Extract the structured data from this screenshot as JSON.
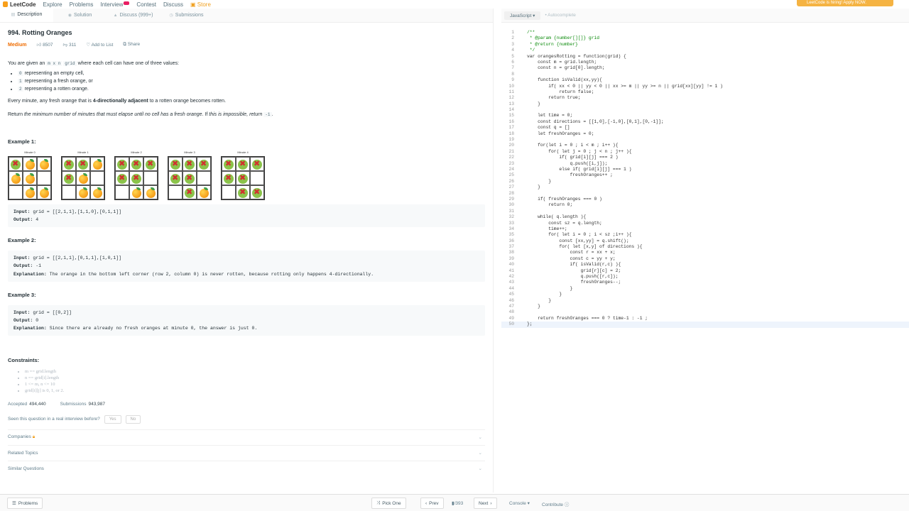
{
  "topnav": {
    "logo": "LeetCode",
    "items": [
      "Explore",
      "Problems",
      "Interview",
      "Contest",
      "Discuss",
      "Store"
    ],
    "banner": "LeetCode is hiring! Apply NOW."
  },
  "tabs": [
    "Description",
    "Solution",
    "Discuss (999+)",
    "Submissions"
  ],
  "problem": {
    "title": "994. Rotting Oranges",
    "difficulty": "Medium",
    "likes": "8507",
    "dislikes": "311",
    "add_to_list": "Add to List",
    "share": "Share",
    "intro_pre": "You are given an",
    "intro_code": "m x n",
    "intro_code2": "grid",
    "intro_post": "where each cell can have one of three values:",
    "values": [
      {
        "code": "0",
        "text": "representing an empty cell,"
      },
      {
        "code": "1",
        "text": "representing a fresh orange, or"
      },
      {
        "code": "2",
        "text": "representing a rotten orange."
      }
    ],
    "para2_pre": "Every minute, any fresh orange that is",
    "para2_bold": "4-directionally adjacent",
    "para2_post": "to a rotten orange becomes rotten.",
    "para3_pre": "Return",
    "para3_italic": "the minimum number of minutes that must elapse until no cell has a fresh orange",
    "para3_mid": ". If",
    "para3_italic2": "this is impossible, return",
    "para3_code": "-1",
    "para3_end": "."
  },
  "examples": [
    {
      "heading": "Example 1:",
      "input": "grid = [[2,1,1],[1,1,0],[0,1,1]]",
      "output": "4",
      "explanation": ""
    },
    {
      "heading": "Example 2:",
      "input": "grid = [[2,1,1],[0,1,1],[1,0,1]]",
      "output": "-1",
      "explanation": "The orange in the bottom left corner (row 2, column 0) is never rotten, because rotting only happens 4-directionally."
    },
    {
      "heading": "Example 3:",
      "input": "grid = [[0,2]]",
      "output": "0",
      "explanation": "Since there are already no fresh oranges at minute 0, the answer is just 0."
    }
  ],
  "labels": {
    "input": "Input:",
    "output": "Output:",
    "explanation": "Explanation:"
  },
  "minutes": [
    {
      "caption": "Minute 0",
      "cells": [
        2,
        1,
        1,
        1,
        1,
        0,
        0,
        1,
        1
      ]
    },
    {
      "caption": "Minute 1",
      "cells": [
        2,
        2,
        1,
        2,
        1,
        0,
        0,
        1,
        1
      ]
    },
    {
      "caption": "Minute 2",
      "cells": [
        2,
        2,
        2,
        2,
        2,
        0,
        0,
        1,
        1
      ]
    },
    {
      "caption": "Minute 3",
      "cells": [
        2,
        2,
        2,
        2,
        2,
        0,
        0,
        2,
        1
      ]
    },
    {
      "caption": "Minute 4",
      "cells": [
        2,
        2,
        2,
        2,
        2,
        0,
        0,
        2,
        2
      ]
    }
  ],
  "constraints": {
    "heading": "Constraints:",
    "items": [
      "m == grid.length",
      "n == grid[i].length",
      "1 <= m, n <= 10",
      "grid[i][j] is 0, 1, or 2."
    ]
  },
  "stats": {
    "accepted_label": "Accepted",
    "accepted": "494,440",
    "submissions_label": "Submissions",
    "submissions": "943,987"
  },
  "seen": {
    "question": "Seen this question in a real interview before?",
    "yes": "Yes",
    "no": "No"
  },
  "sections": [
    "Companies",
    "Related Topics",
    "Similar Questions"
  ],
  "editor": {
    "language": "JavaScript",
    "autocomplete": "Autocomplete",
    "lines": [
      "/**",
      " * @param {number[][]} grid",
      " * @return {number}",
      " */",
      "var orangesRotting = function(grid) {",
      "    const m = grid.length;",
      "    const n = grid[0].length;",
      "",
      "    function isValid(xx,yy){",
      "        if( xx < 0 || yy < 0 || xx >= m || yy >= n || grid[xx][yy] != 1 )",
      "            return false;",
      "        return true;",
      "    }",
      "",
      "    let time = 0;",
      "    const directions = [[1,0],[-1,0],[0,1],[0,-1]];",
      "    const q = []",
      "    let freshOranges = 0;",
      "",
      "    for(let i = 0 ; i < m ; i++ ){",
      "        for( let j = 0 ; j < n ; j++ ){",
      "            if( grid[i][j] === 2 )",
      "                q.push([i,j]);",
      "            else if( grid[i][j] === 1 )",
      "                freshOranges++ ;",
      "        }",
      "    }",
      "",
      "    if( freshOranges === 0 )",
      "        return 0;",
      "",
      "    while( q.length ){",
      "        const sz = q.length;",
      "        time++;",
      "        for( let i = 0 ; i < sz ;i++ ){",
      "            const [xx,yy] = q.shift();",
      "            for( let [x,y] of directions ){",
      "                const r = xx + x;",
      "                const c = yy + y;",
      "                if( isValid(r,c) ){",
      "                    grid[r][c] = 2;",
      "                    q.push([r,c]);",
      "                    freshOranges--;",
      "                }",
      "            }",
      "        }",
      "    }",
      "",
      "    return freshOranges === 0 ? time-1 : -1 ;",
      "};"
    ]
  },
  "bottom": {
    "problems": "Problems",
    "pick_one": "Pick One",
    "prev": "Prev",
    "page": "/393",
    "next": "Next",
    "console": "Console",
    "contribute": "Contribute"
  }
}
